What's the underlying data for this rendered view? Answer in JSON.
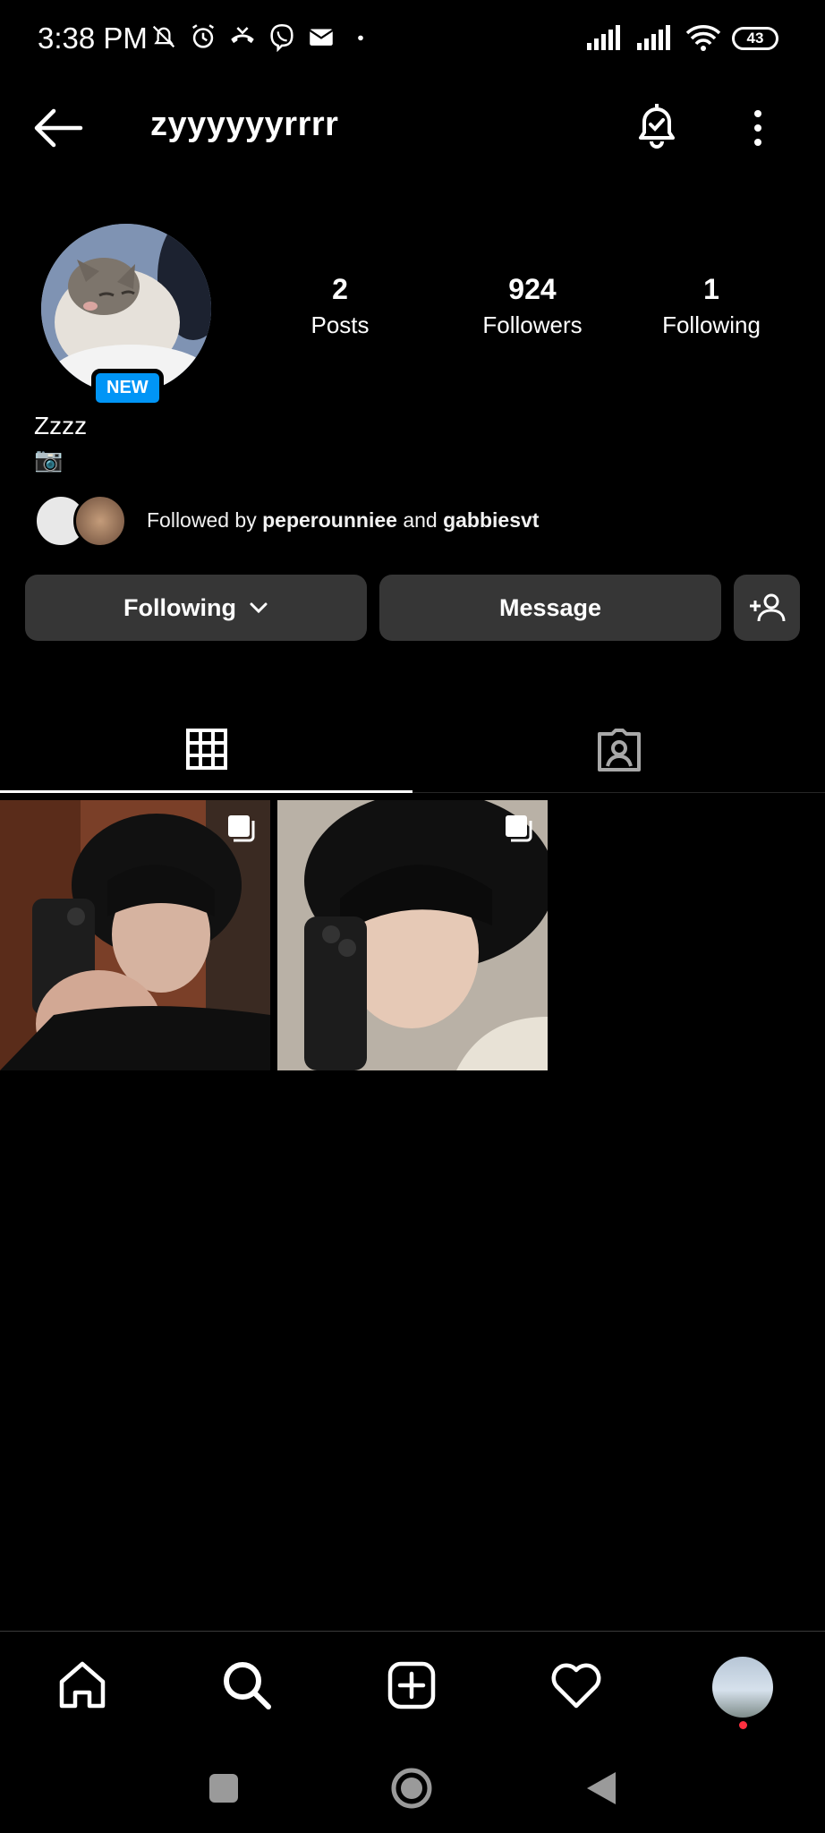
{
  "status_bar": {
    "time": "3:38 PM",
    "battery": "43",
    "icons_left": [
      "mute-icon",
      "alarm-icon",
      "missed-call-icon",
      "viber-icon",
      "mail-icon",
      "dot-icon"
    ],
    "icons_right": [
      "signal-icon",
      "signal-icon",
      "wifi-icon",
      "battery-icon"
    ]
  },
  "header": {
    "username": "zyyyyyyrrrr",
    "icons": [
      "back-arrow-icon",
      "notification-bell-icon",
      "more-options-icon"
    ]
  },
  "profile": {
    "badge": "NEW",
    "display_name": "Zzzz",
    "bio": "📷",
    "stats": {
      "posts_count": "2",
      "posts_label": "Posts",
      "followers_count": "924",
      "followers_label": "Followers",
      "following_count": "1",
      "following_label": "Following"
    },
    "followed_by": {
      "prefix": "Followed by ",
      "user1": "peperounniee",
      "conj": " and ",
      "user2": "gabbiesvt"
    }
  },
  "actions": {
    "following_label": "Following",
    "message_label": "Message",
    "add_user_icon": "add-user-icon"
  },
  "tabs": [
    {
      "name": "grid",
      "icon": "grid-icon",
      "active": true
    },
    {
      "name": "tagged",
      "icon": "tagged-icon",
      "active": false
    }
  ],
  "posts": [
    {
      "type": "carousel"
    },
    {
      "type": "carousel"
    }
  ],
  "bottom_nav": [
    "home-icon",
    "search-icon",
    "create-icon",
    "activity-heart-icon",
    "profile-avatar"
  ],
  "colors": {
    "background": "#000000",
    "button": "#363636",
    "badge": "#0095f6",
    "notification_dot": "#ff3040"
  }
}
